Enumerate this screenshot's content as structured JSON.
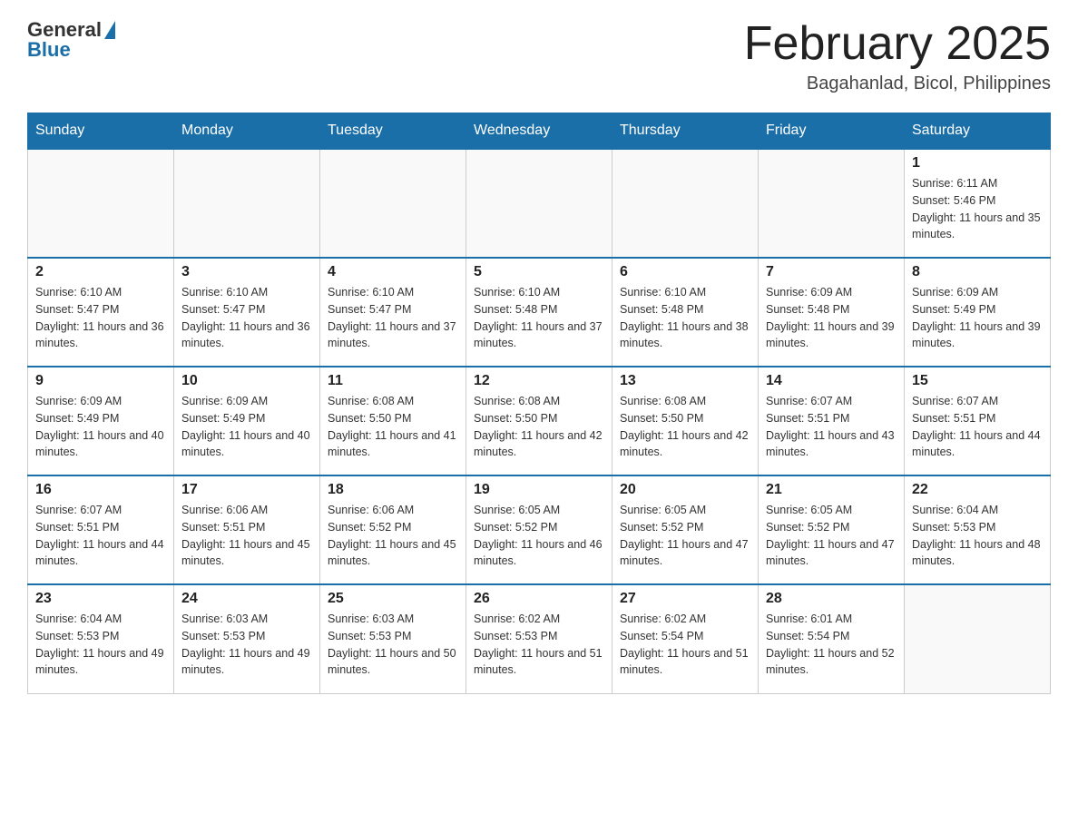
{
  "header": {
    "logo_general": "General",
    "logo_blue": "Blue",
    "title": "February 2025",
    "subtitle": "Bagahanlad, Bicol, Philippines"
  },
  "days_of_week": [
    "Sunday",
    "Monday",
    "Tuesday",
    "Wednesday",
    "Thursday",
    "Friday",
    "Saturday"
  ],
  "weeks": [
    [
      {
        "day": "",
        "sunrise": "",
        "sunset": "",
        "daylight": ""
      },
      {
        "day": "",
        "sunrise": "",
        "sunset": "",
        "daylight": ""
      },
      {
        "day": "",
        "sunrise": "",
        "sunset": "",
        "daylight": ""
      },
      {
        "day": "",
        "sunrise": "",
        "sunset": "",
        "daylight": ""
      },
      {
        "day": "",
        "sunrise": "",
        "sunset": "",
        "daylight": ""
      },
      {
        "day": "",
        "sunrise": "",
        "sunset": "",
        "daylight": ""
      },
      {
        "day": "1",
        "sunrise": "Sunrise: 6:11 AM",
        "sunset": "Sunset: 5:46 PM",
        "daylight": "Daylight: 11 hours and 35 minutes."
      }
    ],
    [
      {
        "day": "2",
        "sunrise": "Sunrise: 6:10 AM",
        "sunset": "Sunset: 5:47 PM",
        "daylight": "Daylight: 11 hours and 36 minutes."
      },
      {
        "day": "3",
        "sunrise": "Sunrise: 6:10 AM",
        "sunset": "Sunset: 5:47 PM",
        "daylight": "Daylight: 11 hours and 36 minutes."
      },
      {
        "day": "4",
        "sunrise": "Sunrise: 6:10 AM",
        "sunset": "Sunset: 5:47 PM",
        "daylight": "Daylight: 11 hours and 37 minutes."
      },
      {
        "day": "5",
        "sunrise": "Sunrise: 6:10 AM",
        "sunset": "Sunset: 5:48 PM",
        "daylight": "Daylight: 11 hours and 37 minutes."
      },
      {
        "day": "6",
        "sunrise": "Sunrise: 6:10 AM",
        "sunset": "Sunset: 5:48 PM",
        "daylight": "Daylight: 11 hours and 38 minutes."
      },
      {
        "day": "7",
        "sunrise": "Sunrise: 6:09 AM",
        "sunset": "Sunset: 5:48 PM",
        "daylight": "Daylight: 11 hours and 39 minutes."
      },
      {
        "day": "8",
        "sunrise": "Sunrise: 6:09 AM",
        "sunset": "Sunset: 5:49 PM",
        "daylight": "Daylight: 11 hours and 39 minutes."
      }
    ],
    [
      {
        "day": "9",
        "sunrise": "Sunrise: 6:09 AM",
        "sunset": "Sunset: 5:49 PM",
        "daylight": "Daylight: 11 hours and 40 minutes."
      },
      {
        "day": "10",
        "sunrise": "Sunrise: 6:09 AM",
        "sunset": "Sunset: 5:49 PM",
        "daylight": "Daylight: 11 hours and 40 minutes."
      },
      {
        "day": "11",
        "sunrise": "Sunrise: 6:08 AM",
        "sunset": "Sunset: 5:50 PM",
        "daylight": "Daylight: 11 hours and 41 minutes."
      },
      {
        "day": "12",
        "sunrise": "Sunrise: 6:08 AM",
        "sunset": "Sunset: 5:50 PM",
        "daylight": "Daylight: 11 hours and 42 minutes."
      },
      {
        "day": "13",
        "sunrise": "Sunrise: 6:08 AM",
        "sunset": "Sunset: 5:50 PM",
        "daylight": "Daylight: 11 hours and 42 minutes."
      },
      {
        "day": "14",
        "sunrise": "Sunrise: 6:07 AM",
        "sunset": "Sunset: 5:51 PM",
        "daylight": "Daylight: 11 hours and 43 minutes."
      },
      {
        "day": "15",
        "sunrise": "Sunrise: 6:07 AM",
        "sunset": "Sunset: 5:51 PM",
        "daylight": "Daylight: 11 hours and 44 minutes."
      }
    ],
    [
      {
        "day": "16",
        "sunrise": "Sunrise: 6:07 AM",
        "sunset": "Sunset: 5:51 PM",
        "daylight": "Daylight: 11 hours and 44 minutes."
      },
      {
        "day": "17",
        "sunrise": "Sunrise: 6:06 AM",
        "sunset": "Sunset: 5:51 PM",
        "daylight": "Daylight: 11 hours and 45 minutes."
      },
      {
        "day": "18",
        "sunrise": "Sunrise: 6:06 AM",
        "sunset": "Sunset: 5:52 PM",
        "daylight": "Daylight: 11 hours and 45 minutes."
      },
      {
        "day": "19",
        "sunrise": "Sunrise: 6:05 AM",
        "sunset": "Sunset: 5:52 PM",
        "daylight": "Daylight: 11 hours and 46 minutes."
      },
      {
        "day": "20",
        "sunrise": "Sunrise: 6:05 AM",
        "sunset": "Sunset: 5:52 PM",
        "daylight": "Daylight: 11 hours and 47 minutes."
      },
      {
        "day": "21",
        "sunrise": "Sunrise: 6:05 AM",
        "sunset": "Sunset: 5:52 PM",
        "daylight": "Daylight: 11 hours and 47 minutes."
      },
      {
        "day": "22",
        "sunrise": "Sunrise: 6:04 AM",
        "sunset": "Sunset: 5:53 PM",
        "daylight": "Daylight: 11 hours and 48 minutes."
      }
    ],
    [
      {
        "day": "23",
        "sunrise": "Sunrise: 6:04 AM",
        "sunset": "Sunset: 5:53 PM",
        "daylight": "Daylight: 11 hours and 49 minutes."
      },
      {
        "day": "24",
        "sunrise": "Sunrise: 6:03 AM",
        "sunset": "Sunset: 5:53 PM",
        "daylight": "Daylight: 11 hours and 49 minutes."
      },
      {
        "day": "25",
        "sunrise": "Sunrise: 6:03 AM",
        "sunset": "Sunset: 5:53 PM",
        "daylight": "Daylight: 11 hours and 50 minutes."
      },
      {
        "day": "26",
        "sunrise": "Sunrise: 6:02 AM",
        "sunset": "Sunset: 5:53 PM",
        "daylight": "Daylight: 11 hours and 51 minutes."
      },
      {
        "day": "27",
        "sunrise": "Sunrise: 6:02 AM",
        "sunset": "Sunset: 5:54 PM",
        "daylight": "Daylight: 11 hours and 51 minutes."
      },
      {
        "day": "28",
        "sunrise": "Sunrise: 6:01 AM",
        "sunset": "Sunset: 5:54 PM",
        "daylight": "Daylight: 11 hours and 52 minutes."
      },
      {
        "day": "",
        "sunrise": "",
        "sunset": "",
        "daylight": ""
      }
    ]
  ]
}
